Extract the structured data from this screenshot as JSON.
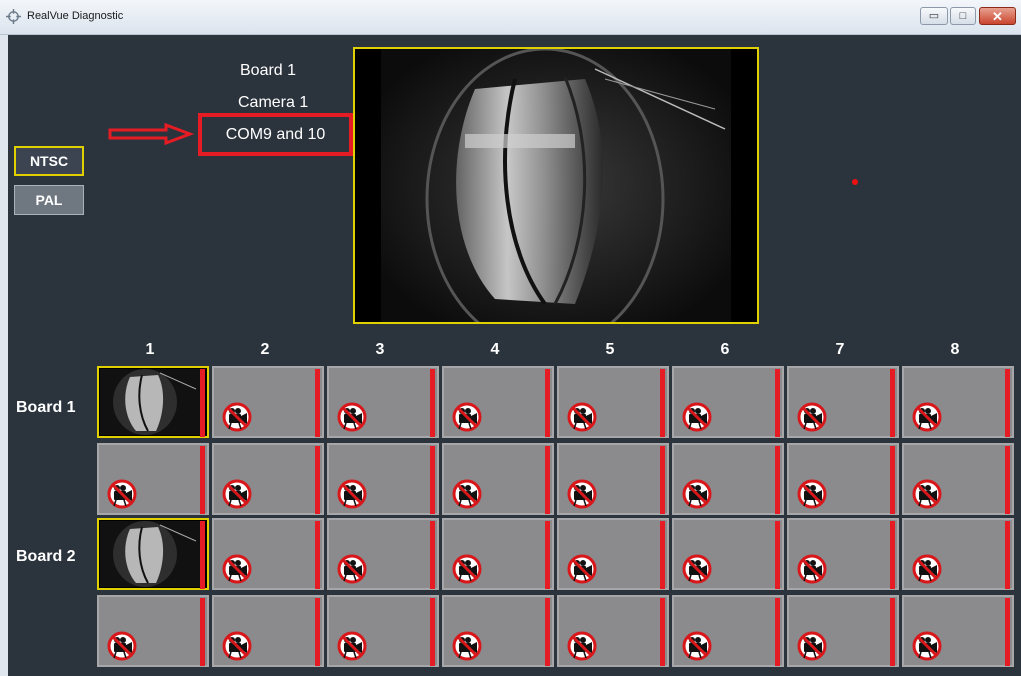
{
  "window": {
    "title": "RealVue Diagnostic",
    "min_glyph": "▭",
    "max_glyph": "□",
    "close_glyph": "✕"
  },
  "info": {
    "board": "Board 1",
    "camera": "Camera 1",
    "com": "COM9 and 10"
  },
  "standards": {
    "ntsc": "NTSC",
    "pal": "PAL"
  },
  "grid": {
    "columns": [
      "1",
      "2",
      "3",
      "4",
      "5",
      "6",
      "7",
      "8"
    ],
    "boards": [
      "Board 1",
      "Board 2"
    ],
    "active_cells": [
      [
        0,
        0
      ],
      [
        2,
        0
      ]
    ]
  },
  "colors": {
    "highlight": "#e51c23",
    "selected_border": "#e0d000",
    "background": "#2b333d",
    "cell_background": "#8b8a8c"
  },
  "icons": {
    "no_camera": "no-camera-icon",
    "arrow": "arrow-right-icon"
  }
}
